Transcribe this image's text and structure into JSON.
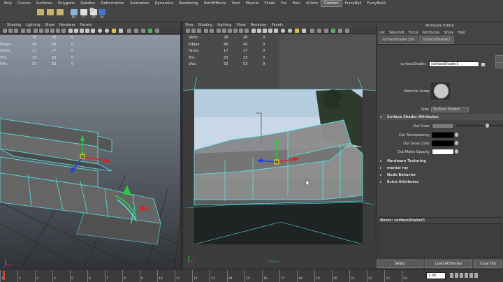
{
  "shelf": {
    "tabs": [
      "Poly",
      "Curves",
      "Surfaces",
      "Polygons",
      "Subdivs",
      "Deformation",
      "Animation",
      "Dynamics",
      "Rendering",
      "PaintEffects",
      "Toon",
      "Muscle",
      "Fluids",
      "Fur",
      "Hair",
      "nCloth",
      "Custom",
      "FurryBall",
      "FurryBall1"
    ],
    "active_tab": "Custom",
    "icons": [
      {
        "name": "cube-icon",
        "label": ""
      },
      {
        "name": "texture-icon",
        "label": ""
      },
      {
        "name": "pattern-icon",
        "label": ""
      },
      {
        "name": "file-icon",
        "label": "Me"
      },
      {
        "name": "freeze-transform-icon",
        "label": "FT"
      },
      {
        "name": "center-pivot-icon",
        "label": "CP"
      },
      {
        "name": "camera-icon",
        "label": ""
      },
      {
        "name": "all-icon",
        "label": "All"
      }
    ]
  },
  "left_panel": {
    "menu": [
      "Shading",
      "Lighting",
      "Show",
      "Renderer",
      "Panels"
    ],
    "hud": [
      {
        "label": "",
        "a": "28",
        "b": "28",
        "c": "0"
      },
      {
        "label": "Edges:",
        "a": "44",
        "b": "44",
        "c": "0"
      },
      {
        "label": "Faces:",
        "a": "17",
        "b": "17",
        "c": "0"
      },
      {
        "label": "Tris:",
        "a": "33",
        "b": "33",
        "c": "0"
      },
      {
        "label": "UVs:",
        "a": "53",
        "b": "53",
        "c": "0"
      }
    ]
  },
  "right_panel": {
    "menu": [
      "View",
      "Shading",
      "Lighting",
      "Show",
      "Renderer",
      "Panels"
    ],
    "hud": [
      {
        "label": "Verts:",
        "a": "28",
        "b": "28",
        "c": "0"
      },
      {
        "label": "Edges:",
        "a": "44",
        "b": "44",
        "c": "0"
      },
      {
        "label": "Faces:",
        "a": "17",
        "b": "17",
        "c": "0"
      },
      {
        "label": "Tris:",
        "a": "33",
        "b": "33",
        "c": "0"
      },
      {
        "label": "UVs:",
        "a": "53",
        "b": "53",
        "c": "0"
      }
    ],
    "camera_label": "camera"
  },
  "attribute_editor": {
    "title": "Attribute Editor",
    "menu": [
      "List",
      "Selected",
      "Focus",
      "Attributes",
      "Show",
      "Help"
    ],
    "tabs": [
      "surfaceShader1SG",
      "surfaceShader1"
    ],
    "active_tab": "surfaceShader1",
    "node_label": "surfaceShader:",
    "node_value": "surfaceShader1",
    "material_sample_label": "Material Sample",
    "type_label": "Type",
    "type_value": "Surface Shader",
    "sections": {
      "surface_shader_attributes": "Surface Shader Attributes",
      "hardware_texturing": "Hardware Texturing",
      "mental_ray": "mental ray",
      "node_behavior": "Node Behavior",
      "extra_attributes": "Extra Attributes"
    },
    "attributes": [
      {
        "label": "Out Color",
        "swatch": "#7a7a7a"
      },
      {
        "label": "Out Transparency",
        "swatch": "#000000"
      },
      {
        "label": "Out Glow Color",
        "swatch": "#000000"
      },
      {
        "label": "Out Matte Opacity",
        "swatch": "#ffffff"
      }
    ],
    "notes_label": "Notes:  surfaceShader1",
    "buttons": [
      "Select",
      "Load Attributes",
      "Copy Tab"
    ]
  },
  "timeline": {
    "frame_value": "1.00",
    "ticks": [
      "1",
      "2",
      "3",
      "4",
      "5",
      "6",
      "7",
      "8",
      "9",
      "10",
      "11",
      "12",
      "13",
      "14",
      "15",
      "16",
      "17",
      "18",
      "19",
      "20",
      "21",
      "22",
      "23",
      "24"
    ]
  },
  "colors": {
    "accent_tab": "#5d5d5d",
    "selection_wire": "#5fd7d7"
  }
}
